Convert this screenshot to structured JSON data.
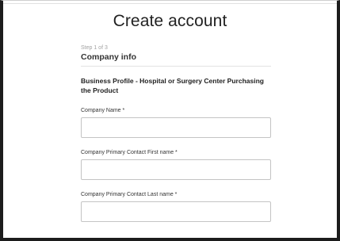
{
  "page": {
    "title": "Create account"
  },
  "form": {
    "step_label": "Step 1 of 3",
    "section_title": "Company info",
    "profile_heading": "Business Profile - Hospital or Surgery Center Purchasing the Product",
    "fields": [
      {
        "label": "Company Name *",
        "value": "",
        "placeholder": ""
      },
      {
        "label": "Company Primary Contact First name *",
        "value": "",
        "placeholder": ""
      },
      {
        "label": "Company Primary Contact Last name *",
        "value": "",
        "placeholder": ""
      }
    ]
  }
}
